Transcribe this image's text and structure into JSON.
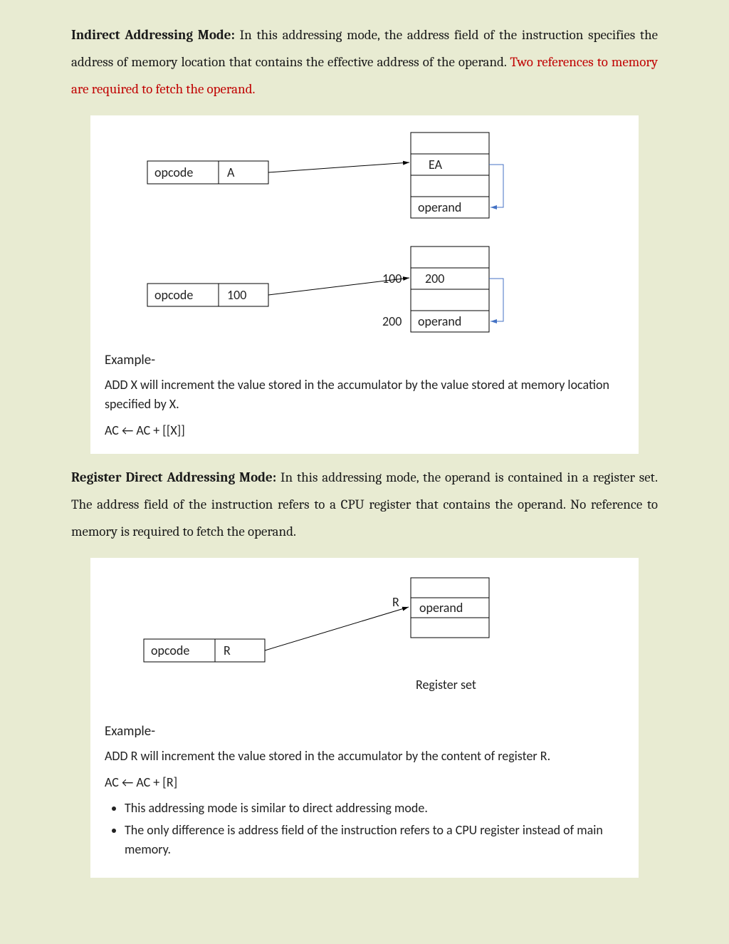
{
  "section1": {
    "title": "Indirect Addressing Mode:",
    "body1": " In this addressing mode, the address field of the instruction specifies the address of memory location that contains the effective address of the operand. ",
    "body_red": "Two references to memory are required to fetch the operand."
  },
  "fig1": {
    "instr_top": {
      "opcode": "opcode",
      "addr": "A"
    },
    "mem_top": {
      "ea": "EA",
      "operand": "operand"
    },
    "instr_bot": {
      "opcode": "opcode",
      "addr": "100"
    },
    "mem_bot": {
      "addr100_label": "100",
      "addr200_label": "200",
      "val_at_100": "200",
      "operand": "operand"
    },
    "example_heading": "Example-",
    "example_body": "ADD X will increment the value stored in the accumulator by the value stored at memory location specified by X.",
    "formula": "AC ← AC + [[X]]"
  },
  "section2": {
    "title": "Register Direct Addressing Mode:",
    "body": " In this addressing mode, the operand is contained in a register set. The address field of the instruction refers to a CPU register that contains the operand. No reference to memory is required to fetch the operand."
  },
  "fig2": {
    "instr": {
      "opcode": "opcode",
      "addr": "R"
    },
    "reg": {
      "operand": "operand",
      "pointer_label": "R",
      "caption": "Register set"
    },
    "example_heading": "Example-",
    "example_body": "ADD R will increment the value stored in the accumulator by the content of register R.",
    "formula": "AC ← AC + [R]",
    "notes": [
      "This addressing mode is similar to direct addressing mode.",
      "The only difference is address field of the instruction refers to a CPU register instead of main memory."
    ]
  }
}
